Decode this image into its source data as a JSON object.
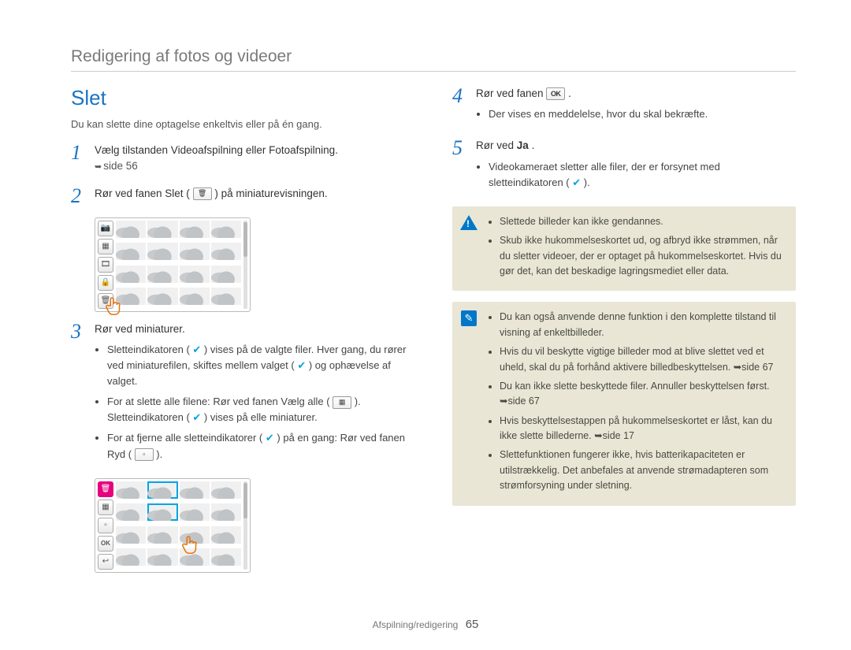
{
  "chapter_title": "Redigering af fotos og videoer",
  "section_title": "Slet",
  "intro": "Du kan slette dine optagelse enkeltvis eller på én gang.",
  "steps_left": [
    {
      "num": "1",
      "text": "Vælg tilstanden Videoafspilning eller Fotoafspilning.",
      "page_ref": "side 56"
    },
    {
      "num": "2",
      "text_before": "Rør ved fanen Slet (",
      "text_after": ") på miniaturevisningen.",
      "icon": "trash"
    },
    {
      "num": "3",
      "text": "Rør ved miniaturer.",
      "bullets": [
        {
          "parts": [
            "Sletteindikatoren ( ",
            {
              "icon": "check"
            },
            " ) vises på de valgte filer. Hver gang, du rører ved miniaturefilen, skiftes mellem valget ( ",
            {
              "icon": "check"
            },
            " ) og ophævelse af valget."
          ]
        },
        {
          "parts": [
            "For at slette alle filene: Rør ved fanen Vælg alle ( ",
            {
              "icon": "selectall"
            },
            " ). Sletteindikatoren ( ",
            {
              "icon": "check"
            },
            " ) vises på elle miniaturer."
          ]
        },
        {
          "parts": [
            "For at fjerne alle sletteindikatorer ( ",
            {
              "icon": "check"
            },
            " ) på en gang: Rør ved fanen Ryd ( ",
            {
              "icon": "clear"
            },
            " )."
          ]
        }
      ]
    }
  ],
  "steps_right": [
    {
      "num": "4",
      "text_before": "Rør ved fanen ",
      "icon": "OK",
      "text_after": ".",
      "bullets": [
        "Der vises en meddelelse, hvor du skal bekræfte."
      ]
    },
    {
      "num": "5",
      "text_before": "Rør ved ",
      "bold": "Ja",
      "text_after": ".",
      "bullets_with_icon": {
        "text_before": "Videokameraet sletter alle filer, der er forsynet med sletteindikatoren ( ",
        "icon": "check",
        "text_after": " )."
      }
    }
  ],
  "warning_box": [
    "Slettede billeder kan ikke gendannes.",
    "Skub ikke hukommelseskortet ud, og afbryd ikke strømmen, når du sletter videoer, der er optaget på hukommelseskortet. Hvis du gør det, kan det beskadige lagringsmediet eller data."
  ],
  "info_box": [
    "Du kan også anvende denne funktion i den komplette tilstand til visning af enkeltbilleder.",
    "Hvis du vil beskytte vigtige billeder mod at blive slettet ved et uheld, skal du på forhånd aktivere billedbeskyttelsen. ➥side 67",
    "Du kan ikke slette beskyttede filer. Annuller beskyttelsen først. ➥side 67",
    "Hvis beskyttelsestappen på hukommelseskortet er låst, kan du ikke slette billederne. ➥side 17",
    "Slettefunktionen fungerer ikke, hvis batterikapaciteten er utilstrækkelig. Det anbefales at anvende strømadapteren som strømforsyning under sletning."
  ],
  "thumb1_sidebar": [
    "📷",
    "▦",
    "🎞",
    "🔒",
    "🗑"
  ],
  "thumb2_sidebar": [
    "🗑",
    "▦",
    "▫",
    "OK",
    "↩"
  ],
  "footer_section": "Afspilning/redigering",
  "page_number": "65"
}
